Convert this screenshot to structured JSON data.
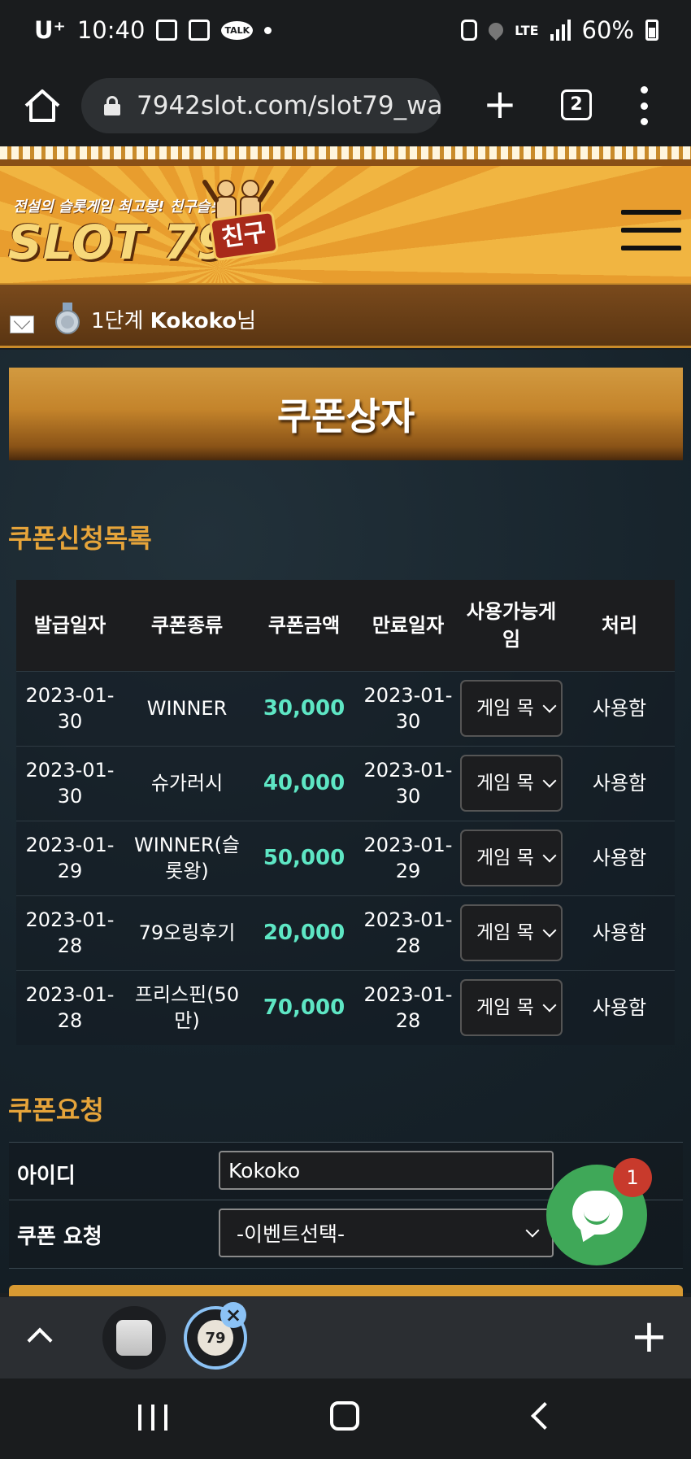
{
  "status_bar": {
    "carrier": "U⁺",
    "time": "10:40",
    "talk_badge": "TALK",
    "network": "LTE",
    "battery": "60%"
  },
  "browser": {
    "url": "7942slot.com/slot79_wa",
    "tab_count": "2"
  },
  "site_header": {
    "tagline": "전설의 슬롯게임 최고봉! 친구슬롯",
    "logo_text": "SLOT 79",
    "logo_badge": "친구"
  },
  "user_bar": {
    "level": "1단계",
    "username": "Kokoko",
    "suffix": "님"
  },
  "page": {
    "title": "쿠폰상자",
    "list_section_title": "쿠폰신청목록",
    "request_section_title": "쿠폰요청"
  },
  "coupon_table": {
    "headers": [
      "발급일자",
      "쿠폰종류",
      "쿠폰금액",
      "만료일자",
      "사용가능게임",
      "처리"
    ],
    "rows": [
      {
        "issued": "2023-01-30",
        "type": "WINNER",
        "amount": "30,000",
        "expires": "2023-01-30",
        "game": "게임 목",
        "status": "사용함"
      },
      {
        "issued": "2023-01-30",
        "type": "슈가러시",
        "amount": "40,000",
        "expires": "2023-01-30",
        "game": "게임 목",
        "status": "사용함"
      },
      {
        "issued": "2023-01-29",
        "type": "WINNER(슬롯왕)",
        "amount": "50,000",
        "expires": "2023-01-29",
        "game": "게임 목",
        "status": "사용함"
      },
      {
        "issued": "2023-01-28",
        "type": "79오링후기",
        "amount": "20,000",
        "expires": "2023-01-28",
        "game": "게임 목",
        "status": "사용함"
      },
      {
        "issued": "2023-01-28",
        "type": "프리스핀(50만)",
        "amount": "70,000",
        "expires": "2023-01-28",
        "game": "게임 목",
        "status": "사용함"
      }
    ]
  },
  "request_form": {
    "id_label": "아이디",
    "id_value": "Kokoko",
    "coupon_label": "쿠폰 요청",
    "coupon_select_value": "-이벤트선택-"
  },
  "chat": {
    "unread_count": "1"
  },
  "tab_strip": {
    "active_tab_label": "79"
  },
  "colors": {
    "accent_gold": "#e6a43a",
    "amount_teal": "#5ee6c4",
    "chat_green": "#3fa858",
    "badge_red": "#c83a2c"
  }
}
